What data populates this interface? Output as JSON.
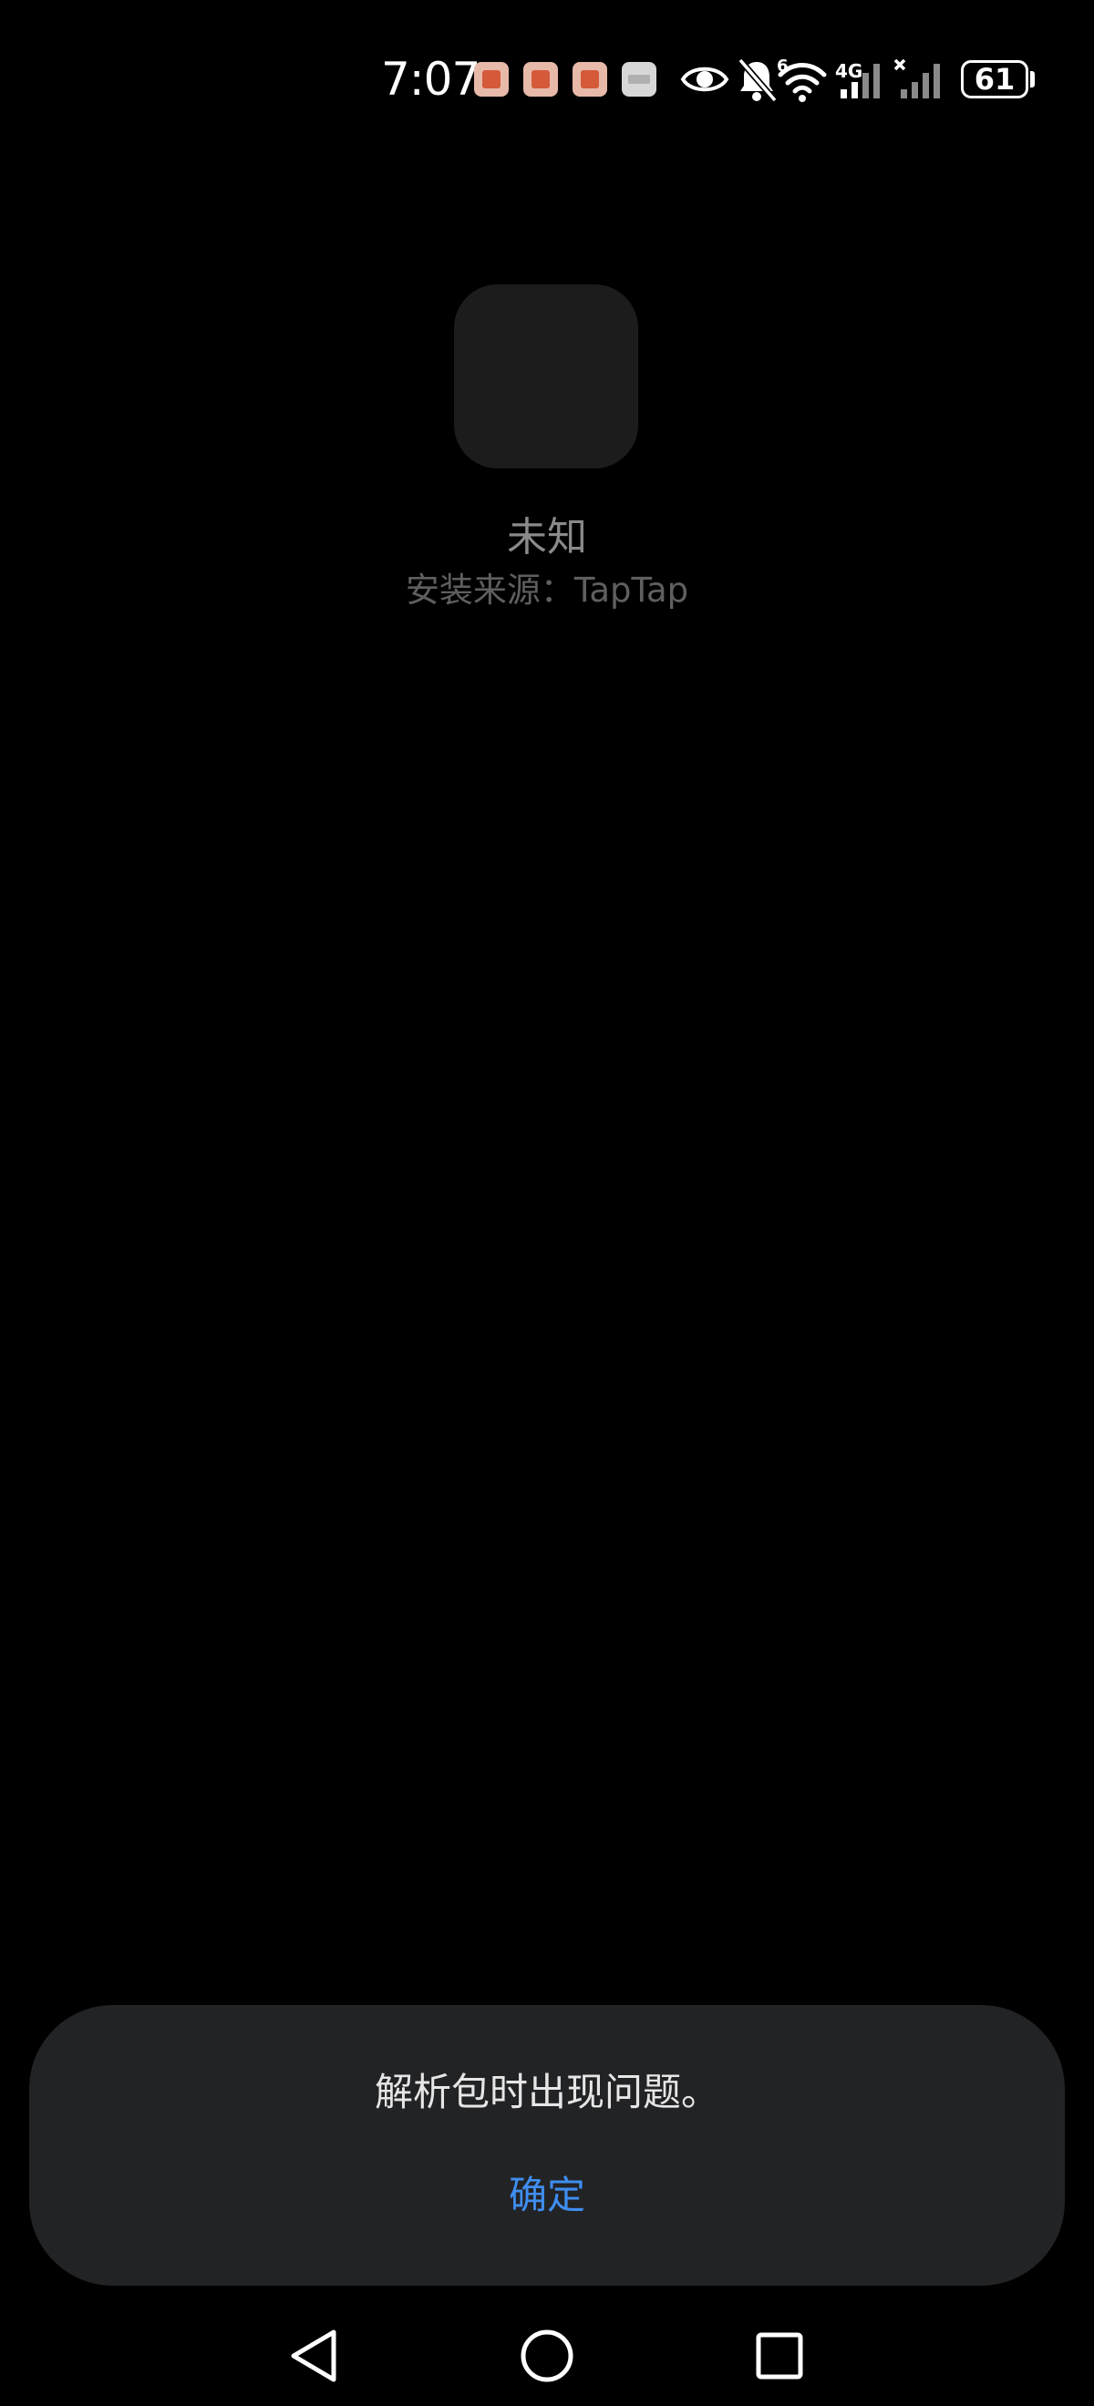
{
  "status_bar": {
    "time": "7:07",
    "network_type": "4G",
    "wifi_label": "6",
    "battery_level": "61",
    "icons": [
      "book-notification-icon",
      "book-notification-icon",
      "book-notification-icon",
      "huawei-store-notification-icon",
      "eye-icon",
      "bell-muted-icon",
      "wifi-icon",
      "cellular-signal-icon",
      "cellular-signal-no-service-icon",
      "battery-icon"
    ]
  },
  "app": {
    "name": "未知",
    "install_source": "安装来源：TapTap"
  },
  "dialog": {
    "message": "解析包时出现问题。",
    "confirm_label": "确定",
    "confirm_color": "#3f8ef0"
  },
  "nav_bar": {
    "buttons": [
      "back-icon",
      "home-icon",
      "recents-icon"
    ]
  }
}
